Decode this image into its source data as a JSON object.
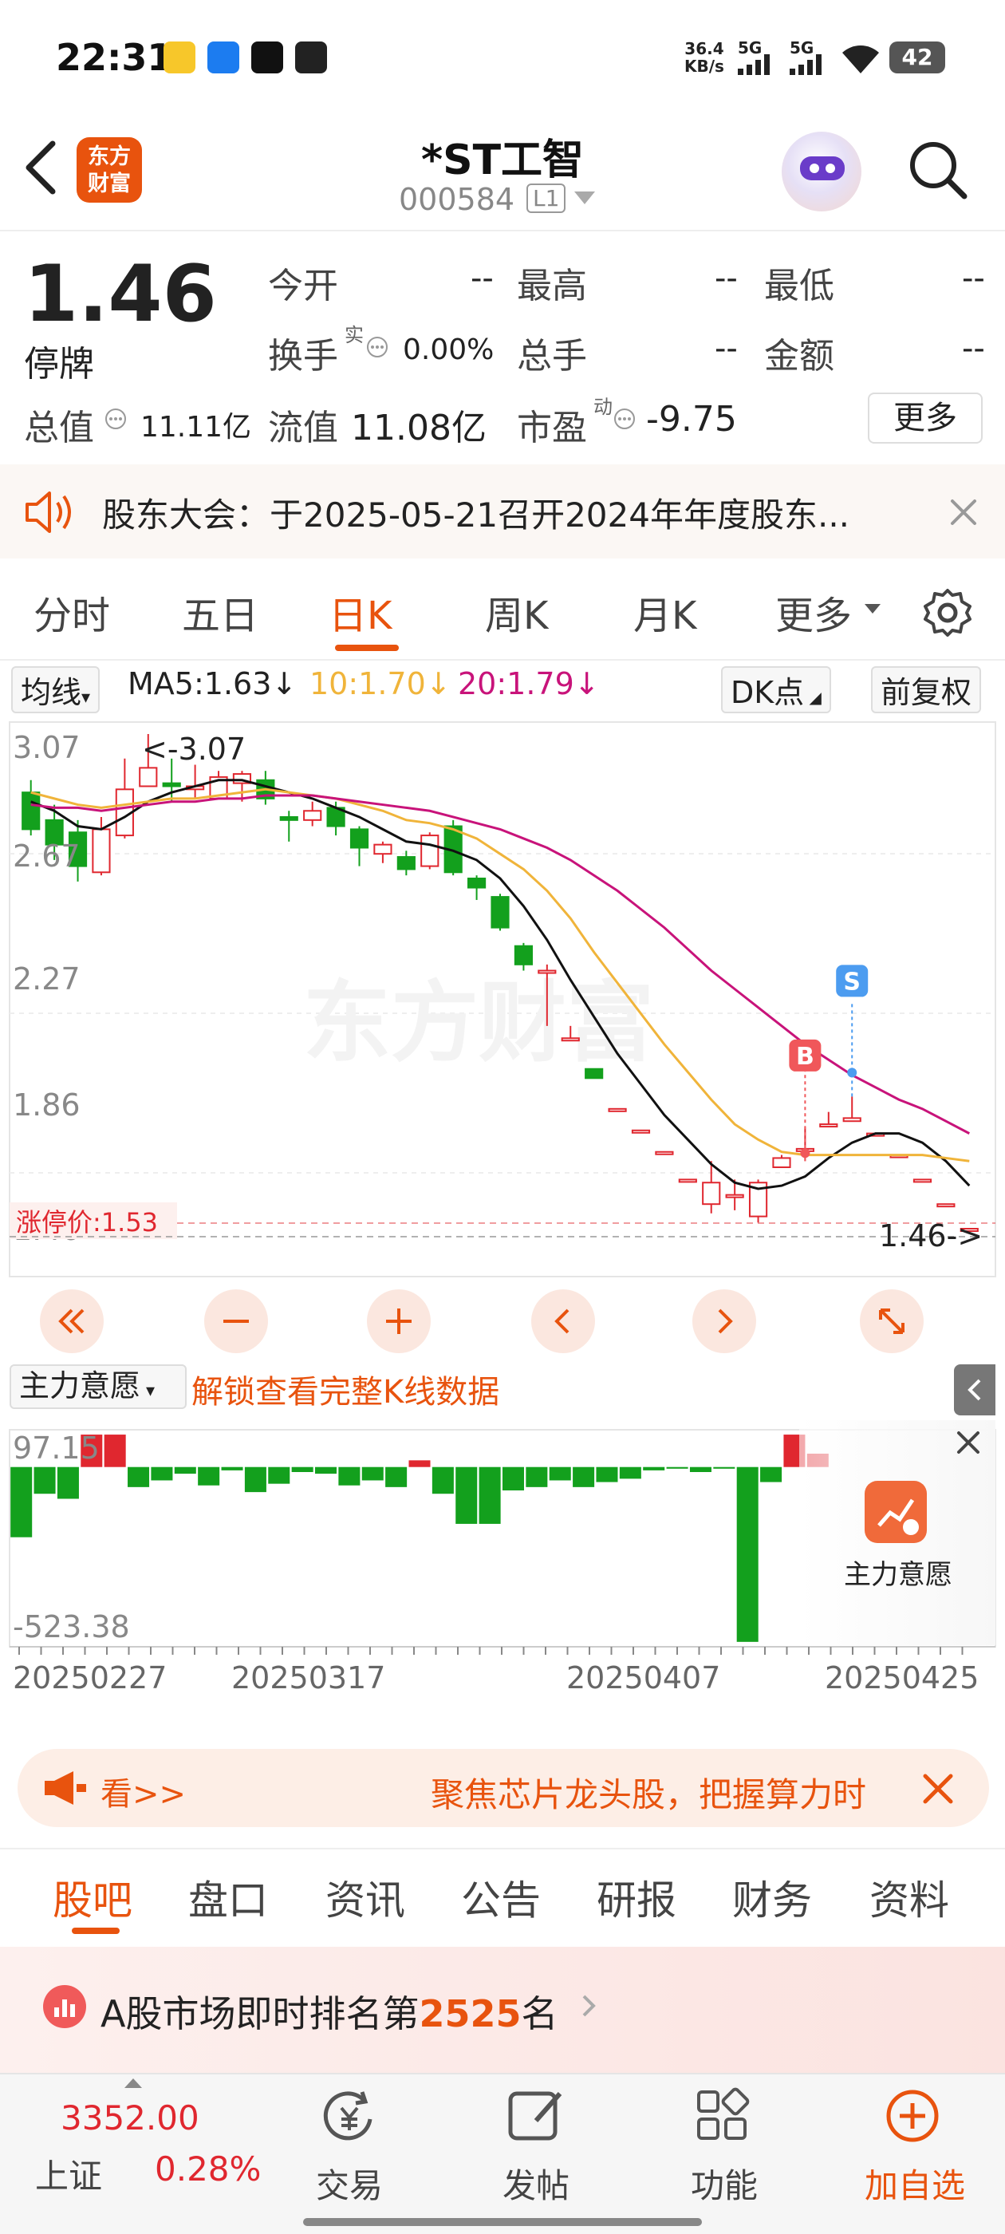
{
  "status_bar": {
    "time": "22:31",
    "net_speed": "36.4",
    "net_unit": "KB/s",
    "sim1": "5G",
    "sim2": "5G",
    "battery": "42"
  },
  "header": {
    "back_icon": "chevron-left-icon",
    "logo_line1": "东方",
    "logo_line2": "财富",
    "stock_name": "*ST工智",
    "stock_code": "000584",
    "level_badge": "L1",
    "search_icon": "search-icon"
  },
  "quote": {
    "price": "1.46",
    "status": "停牌",
    "fields": [
      {
        "label": "今开",
        "value": "--"
      },
      {
        "label": "最高",
        "value": "--"
      },
      {
        "label": "最低",
        "value": "--"
      },
      {
        "label": "换手",
        "sup": "实",
        "value": "0.00%"
      },
      {
        "label": "总手",
        "value": "--"
      },
      {
        "label": "金额",
        "value": "--"
      }
    ],
    "total_value_label": "总值",
    "total_value": "11.11亿",
    "float_value_label": "流值",
    "float_value": "11.08亿",
    "pe_label": "市盈",
    "pe_sup": "动",
    "pe_value": "-9.75",
    "more_button": "更多"
  },
  "notice": {
    "text": "股东大会：于2025-05-21召开2024年年度股东..."
  },
  "kline_tabs": [
    "分时",
    "五日",
    "日K",
    "周K",
    "月K",
    "更多"
  ],
  "kline_active": "日K",
  "ma_row": {
    "indicator": "均线",
    "ma5": "MA5:1.63",
    "ma10": "10:1.70",
    "ma20": "20:1.79",
    "dk_button": "DK点",
    "adjust_button": "前复权"
  },
  "colors": {
    "brand": "#e8530e",
    "up": "#e0272f",
    "down": "#13a01d",
    "ma5": "#111111",
    "ma10": "#f0b43a",
    "ma20": "#c8137a",
    "buy_marker": "#f0575a",
    "sell_marker": "#4c9cf0"
  },
  "chart_data": {
    "type": "candlestick",
    "price_axis_ticks": [
      "3.07",
      "2.67",
      "2.27",
      "1.86",
      "1.46"
    ],
    "ylim": [
      1.46,
      3.07
    ],
    "max_annotation": "<-3.07",
    "last_price_annotation": "1.46->",
    "limit_up_label": "涨停价:1.53",
    "buy_marker": "B",
    "sell_marker": "S",
    "x_tick_labels": [
      "20250227",
      "20250317",
      "20250407",
      "20250425"
    ],
    "candles": [
      {
        "o": 2.88,
        "c": 2.76,
        "h": 2.92,
        "l": 2.74
      },
      {
        "o": 2.79,
        "c": 2.71,
        "h": 2.84,
        "l": 2.66
      },
      {
        "o": 2.75,
        "c": 2.64,
        "h": 2.79,
        "l": 2.59
      },
      {
        "o": 2.62,
        "c": 2.76,
        "h": 2.8,
        "l": 2.61
      },
      {
        "o": 2.74,
        "c": 2.89,
        "h": 2.99,
        "l": 2.73
      },
      {
        "o": 2.9,
        "c": 2.96,
        "h": 3.07,
        "l": 2.9
      },
      {
        "o": 2.91,
        "c": 2.9,
        "h": 2.99,
        "l": 2.85
      },
      {
        "o": 2.89,
        "c": 2.9,
        "h": 2.97,
        "l": 2.86
      },
      {
        "o": 2.86,
        "c": 2.93,
        "h": 2.95,
        "l": 2.86
      },
      {
        "o": 2.91,
        "c": 2.94,
        "h": 2.95,
        "l": 2.85
      },
      {
        "o": 2.92,
        "c": 2.86,
        "h": 2.95,
        "l": 2.84
      },
      {
        "o": 2.8,
        "c": 2.79,
        "h": 2.82,
        "l": 2.72
      },
      {
        "o": 2.79,
        "c": 2.82,
        "h": 2.85,
        "l": 2.77
      },
      {
        "o": 2.83,
        "c": 2.77,
        "h": 2.85,
        "l": 2.74
      },
      {
        "o": 2.76,
        "c": 2.7,
        "h": 2.77,
        "l": 2.64
      },
      {
        "o": 2.68,
        "c": 2.71,
        "h": 2.72,
        "l": 2.65
      },
      {
        "o": 2.67,
        "c": 2.63,
        "h": 2.69,
        "l": 2.61
      },
      {
        "o": 2.64,
        "c": 2.74,
        "h": 2.75,
        "l": 2.63
      },
      {
        "o": 2.77,
        "c": 2.62,
        "h": 2.79,
        "l": 2.61
      },
      {
        "o": 2.6,
        "c": 2.57,
        "h": 2.61,
        "l": 2.53
      },
      {
        "o": 2.54,
        "c": 2.44,
        "h": 2.55,
        "l": 2.43
      },
      {
        "o": 2.38,
        "c": 2.32,
        "h": 2.39,
        "l": 2.3
      },
      {
        "o": 2.3,
        "c": 2.3,
        "h": 2.32,
        "l": 2.12
      },
      {
        "o": 2.08,
        "c": 2.08,
        "h": 2.12,
        "l": 2.08
      },
      {
        "o": 1.98,
        "c": 1.95,
        "h": 1.98,
        "l": 1.95
      },
      {
        "o": 1.85,
        "c": 1.85,
        "h": 1.85,
        "l": 1.85
      },
      {
        "o": 1.78,
        "c": 1.78,
        "h": 1.78,
        "l": 1.78
      },
      {
        "o": 1.71,
        "c": 1.71,
        "h": 1.71,
        "l": 1.71
      },
      {
        "o": 1.62,
        "c": 1.62,
        "h": 1.62,
        "l": 1.62
      },
      {
        "o": 1.54,
        "c": 1.61,
        "h": 1.68,
        "l": 1.51
      },
      {
        "o": 1.57,
        "c": 1.57,
        "h": 1.62,
        "l": 1.52
      },
      {
        "o": 1.5,
        "c": 1.61,
        "h": 1.62,
        "l": 1.48
      },
      {
        "o": 1.66,
        "c": 1.69,
        "h": 1.7,
        "l": 1.66
      },
      {
        "o": 1.72,
        "c": 1.72,
        "h": 1.79,
        "l": 1.68
      },
      {
        "o": 1.8,
        "c": 1.8,
        "h": 1.84,
        "l": 1.8
      },
      {
        "o": 1.81,
        "c": 1.82,
        "h": 1.89,
        "l": 1.81
      },
      {
        "o": 1.77,
        "c": 1.77,
        "h": 1.77,
        "l": 1.77
      },
      {
        "o": 1.7,
        "c": 1.7,
        "h": 1.7,
        "l": 1.7
      },
      {
        "o": 1.62,
        "c": 1.62,
        "h": 1.62,
        "l": 1.62
      },
      {
        "o": 1.54,
        "c": 1.54,
        "h": 1.54,
        "l": 1.54
      },
      {
        "o": 1.46,
        "c": 1.46,
        "h": 1.46,
        "l": 1.46
      }
    ],
    "ma5": [
      2.85,
      2.82,
      2.77,
      2.76,
      2.8,
      2.85,
      2.88,
      2.9,
      2.92,
      2.92,
      2.9,
      2.88,
      2.86,
      2.83,
      2.8,
      2.76,
      2.72,
      2.71,
      2.69,
      2.66,
      2.6,
      2.51,
      2.4,
      2.27,
      2.15,
      2.03,
      1.93,
      1.83,
      1.75,
      1.67,
      1.61,
      1.59,
      1.6,
      1.63,
      1.69,
      1.74,
      1.77,
      1.77,
      1.74,
      1.68,
      1.6
    ],
    "ma10": [
      2.88,
      2.86,
      2.84,
      2.83,
      2.84,
      2.85,
      2.86,
      2.86,
      2.87,
      2.88,
      2.89,
      2.88,
      2.87,
      2.86,
      2.84,
      2.82,
      2.79,
      2.78,
      2.76,
      2.73,
      2.68,
      2.63,
      2.56,
      2.47,
      2.36,
      2.26,
      2.16,
      2.06,
      1.97,
      1.88,
      1.8,
      1.75,
      1.71,
      1.7,
      1.7,
      1.7,
      1.7,
      1.7,
      1.7,
      1.69,
      1.68
    ],
    "ma20": [
      2.84,
      2.83,
      2.83,
      2.82,
      2.83,
      2.84,
      2.85,
      2.85,
      2.86,
      2.86,
      2.87,
      2.87,
      2.87,
      2.86,
      2.85,
      2.84,
      2.83,
      2.82,
      2.8,
      2.78,
      2.76,
      2.73,
      2.7,
      2.66,
      2.61,
      2.56,
      2.5,
      2.44,
      2.37,
      2.3,
      2.24,
      2.18,
      2.12,
      2.06,
      2.01,
      1.96,
      1.92,
      1.88,
      1.85,
      1.81,
      1.77
    ],
    "buy_index": 33,
    "sell_index": 35,
    "sub_indicator": "主力意愿",
    "sub_unlock_text": "解锁查看完整K线数据",
    "sub_axis_ticks": [
      "97.15",
      "-523.38"
    ],
    "sub_ylim": [
      -523.38,
      97.15
    ],
    "sub_values": [
      -210,
      -80,
      -95,
      97,
      97,
      -60,
      -40,
      -20,
      -55,
      -10,
      -75,
      -50,
      -15,
      -20,
      -55,
      -40,
      -60,
      20,
      -80,
      -170,
      -170,
      -70,
      -60,
      -40,
      -60,
      -45,
      -35,
      -10,
      -5,
      -15,
      -5,
      -523,
      -45,
      97,
      40
    ],
    "sub_panel_label": "主力意愿"
  },
  "ad_banner": {
    "left_text": "看>>",
    "text": "聚焦芯片龙头股，把握算力时"
  },
  "bottom_tabs": [
    "股吧",
    "盘口",
    "资讯",
    "公告",
    "研报",
    "财务",
    "资料"
  ],
  "bottom_active": "股吧",
  "rank": {
    "prefix": "A股市场即时排名第",
    "number": "2525",
    "suffix": "名"
  },
  "bottom_bar": {
    "index_value": "3352.00",
    "index_name": "上证",
    "index_change": "0.28%",
    "items": [
      {
        "label": "交易",
        "icon": "trade-icon"
      },
      {
        "label": "发帖",
        "icon": "post-icon"
      },
      {
        "label": "功能",
        "icon": "grid-icon"
      },
      {
        "label": "加自选",
        "icon": "add-watchlist-icon"
      }
    ]
  }
}
